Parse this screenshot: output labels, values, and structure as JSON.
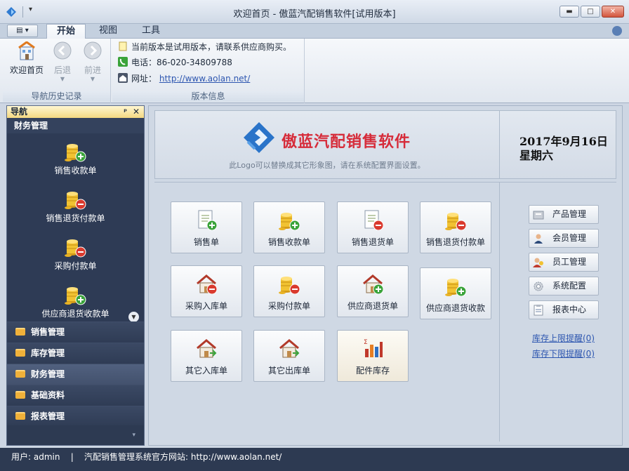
{
  "window": {
    "title": "欢迎首页 - 傲蓝汽配销售软件[试用版本]",
    "controls": {
      "minimize": "▬",
      "maximize": "□",
      "close": "✕"
    }
  },
  "quick_access": {
    "dropdown": "▾"
  },
  "ribbon_tabs": [
    {
      "label": "开始",
      "active": true
    },
    {
      "label": "视图",
      "active": false
    },
    {
      "label": "工具",
      "active": false
    }
  ],
  "app_menu": {
    "label": "▤ ▾"
  },
  "ribbon": {
    "nav_group": {
      "label": "导航历史记录",
      "buttons": [
        {
          "label": "欢迎首页",
          "icon": "home-page-icon",
          "enabled": true
        },
        {
          "label": "后退",
          "icon": "back-arrow-icon",
          "enabled": false
        },
        {
          "label": "前进",
          "icon": "forward-arrow-icon",
          "enabled": false
        }
      ]
    },
    "version_group": {
      "label": "版本信息",
      "notice": "当前版本是试用版本，请联系供应商购买。",
      "phone_label": "电话：",
      "phone": "86-020-34809788",
      "website_label": "网址：",
      "website": "http://www.aolan.net/"
    }
  },
  "nav_panel": {
    "title": "导航",
    "pin": "ᵖ",
    "close": "✕",
    "current_group": "财务管理",
    "items": [
      {
        "label": "销售收款单",
        "icon": "coins-plus-icon"
      },
      {
        "label": "销售退货付款单",
        "icon": "coins-minus-icon"
      },
      {
        "label": "采购付款单",
        "icon": "coins-minus-icon"
      },
      {
        "label": "供应商退货收款单",
        "icon": "coins-plus-icon"
      }
    ],
    "scroll_down": "▼",
    "categories": [
      {
        "label": "销售管理",
        "active": false
      },
      {
        "label": "库存管理",
        "active": false
      },
      {
        "label": "财务管理",
        "active": true
      },
      {
        "label": "基础资料",
        "active": false
      },
      {
        "label": "报表管理",
        "active": false
      }
    ],
    "footer": "▾"
  },
  "banner": {
    "logo_text": "傲蓝汽配销售软件",
    "logo_note": "此Logo可以替换成其它形象图，请在系统配置界面设置。",
    "date": "2017年9月16日",
    "weekday": "星期六"
  },
  "tiles": [
    {
      "label": "销售单",
      "icon": "document-plus-icon"
    },
    {
      "label": "销售收款单",
      "icon": "coins-plus-icon"
    },
    {
      "label": "销售退货单",
      "icon": "document-minus-icon"
    },
    {
      "label": "销售退货付款单",
      "icon": "coins-minus-icon"
    },
    {
      "label": "采购入库单",
      "icon": "house-minus-icon"
    },
    {
      "label": "采购付款单",
      "icon": "coins-minus-icon"
    },
    {
      "label": "供应商退货单",
      "icon": "house-plus-icon"
    },
    {
      "label": "供应商退货收款",
      "icon": "coins-plus-icon"
    },
    {
      "label": "其它入库单",
      "icon": "house-in-icon"
    },
    {
      "label": "其它出库单",
      "icon": "house-out-icon"
    },
    {
      "label": "配件库存",
      "icon": "bar-chart-icon"
    }
  ],
  "side_buttons": [
    {
      "label": "产品管理",
      "icon": "product-icon"
    },
    {
      "label": "会员管理",
      "icon": "member-icon"
    },
    {
      "label": "员工管理",
      "icon": "staff-icon"
    },
    {
      "label": "系统配置",
      "icon": "settings-icon"
    },
    {
      "label": "报表中心",
      "icon": "report-icon"
    }
  ],
  "side_links": [
    {
      "label": "库存上限提醒(0)"
    },
    {
      "label": "库存下限提醒(0)"
    }
  ],
  "status": {
    "user": "用户: admin    |    汽配销售管理系统官方网站: http://www.aolan.net/"
  },
  "colors": {
    "nav_bg": "#2d3a52",
    "header_gold": "#f4d881",
    "logo_red": "#d62c3a",
    "link_blue": "#2d56b0"
  }
}
